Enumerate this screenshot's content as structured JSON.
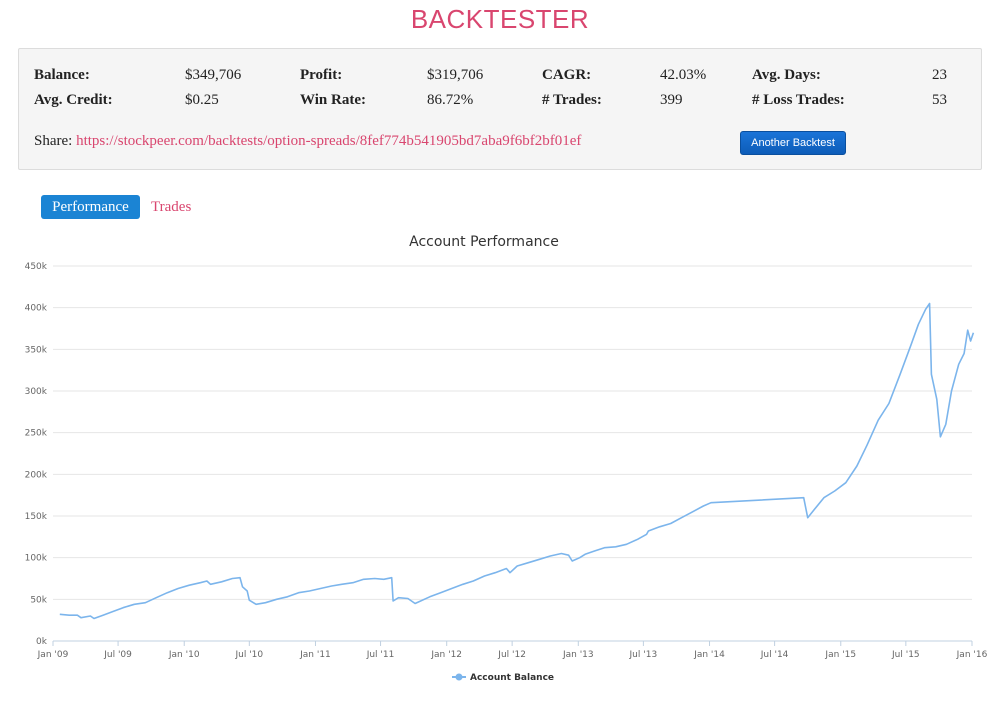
{
  "header": {
    "title": "BACKTESTER"
  },
  "stats": [
    {
      "id": "balance",
      "label": "Balance:",
      "value": "$349,706"
    },
    {
      "id": "profit",
      "label": "Profit:",
      "value": "$319,706"
    },
    {
      "id": "cagr",
      "label": "CAGR:",
      "value": "42.03%"
    },
    {
      "id": "avg-days",
      "label": "Avg. Days:",
      "value": "23"
    },
    {
      "id": "avg-credit",
      "label": "Avg. Credit:",
      "value": "$0.25"
    },
    {
      "id": "win-rate",
      "label": "Win Rate:",
      "value": "86.72%"
    },
    {
      "id": "trades",
      "label": "# Trades:",
      "value": "399"
    },
    {
      "id": "loss-trades",
      "label": "# Loss Trades:",
      "value": "53"
    }
  ],
  "share": {
    "label": "Share:",
    "url": "https://stockpeer.com/backtests/option-spreads/8fef774b541905bd7aba9f6bf2bf01ef"
  },
  "actions": {
    "another_backtest": "Another Backtest"
  },
  "tabs": [
    {
      "label": "Performance",
      "active": true
    },
    {
      "label": "Trades",
      "active": false
    }
  ],
  "colors": {
    "accent": "#d9466f",
    "series": "#7cb5ec",
    "button": "#1565c0",
    "tab_active": "#1b84d4"
  },
  "chart_data": {
    "type": "line",
    "title": "Account Performance",
    "xlabel": "",
    "ylabel": "",
    "x_ticks": [
      "Jan '09",
      "Jul '09",
      "Jan '10",
      "Jul '10",
      "Jan '11",
      "Jul '11",
      "Jan '12",
      "Jul '12",
      "Jan '13",
      "Jul '13",
      "Jan '14",
      "Jul '14",
      "Jan '15",
      "Jul '15",
      "Jan '16"
    ],
    "y_ticks": [
      "0k",
      "50k",
      "100k",
      "150k",
      "200k",
      "250k",
      "300k",
      "350k",
      "400k",
      "450k"
    ],
    "ylim": [
      0,
      450000
    ],
    "xlim": [
      "2009-01-01",
      "2016-01-01"
    ],
    "grid": true,
    "legend": "bottom-center",
    "series": [
      {
        "name": "Account Balance",
        "points": [
          [
            "2009-01-20",
            32000
          ],
          [
            "2009-02-15",
            31000
          ],
          [
            "2009-03-10",
            31000
          ],
          [
            "2009-03-20",
            28000
          ],
          [
            "2009-04-15",
            30000
          ],
          [
            "2009-04-25",
            27000
          ],
          [
            "2009-05-20",
            31000
          ],
          [
            "2009-06-15",
            35000
          ],
          [
            "2009-07-15",
            40000
          ],
          [
            "2009-08-15",
            44000
          ],
          [
            "2009-09-15",
            46000
          ],
          [
            "2009-10-15",
            52000
          ],
          [
            "2009-11-15",
            58000
          ],
          [
            "2009-12-15",
            63000
          ],
          [
            "2010-01-15",
            67000
          ],
          [
            "2010-02-15",
            70000
          ],
          [
            "2010-03-05",
            72000
          ],
          [
            "2010-03-15",
            68000
          ],
          [
            "2010-04-15",
            71000
          ],
          [
            "2010-05-15",
            75000
          ],
          [
            "2010-06-05",
            76000
          ],
          [
            "2010-06-12",
            65000
          ],
          [
            "2010-06-25",
            60000
          ],
          [
            "2010-07-01",
            49000
          ],
          [
            "2010-07-20",
            44000
          ],
          [
            "2010-08-15",
            46000
          ],
          [
            "2010-09-15",
            50000
          ],
          [
            "2010-10-15",
            53000
          ],
          [
            "2010-11-15",
            58000
          ],
          [
            "2010-12-15",
            60000
          ],
          [
            "2011-01-15",
            63000
          ],
          [
            "2011-02-15",
            66000
          ],
          [
            "2011-03-15",
            68000
          ],
          [
            "2011-04-15",
            70000
          ],
          [
            "2011-05-15",
            74000
          ],
          [
            "2011-06-15",
            75000
          ],
          [
            "2011-07-10",
            74000
          ],
          [
            "2011-08-01",
            76000
          ],
          [
            "2011-08-05",
            48000
          ],
          [
            "2011-08-20",
            52000
          ],
          [
            "2011-09-15",
            51000
          ],
          [
            "2011-10-05",
            45000
          ],
          [
            "2011-11-15",
            53000
          ],
          [
            "2011-12-15",
            58000
          ],
          [
            "2012-01-15",
            63000
          ],
          [
            "2012-02-15",
            68000
          ],
          [
            "2012-03-15",
            72000
          ],
          [
            "2012-04-15",
            78000
          ],
          [
            "2012-05-15",
            82000
          ],
          [
            "2012-06-15",
            87000
          ],
          [
            "2012-06-25",
            82000
          ],
          [
            "2012-07-15",
            90000
          ],
          [
            "2012-08-15",
            94000
          ],
          [
            "2012-09-15",
            98000
          ],
          [
            "2012-10-15",
            102000
          ],
          [
            "2012-11-15",
            105000
          ],
          [
            "2012-12-05",
            103000
          ],
          [
            "2012-12-15",
            96000
          ],
          [
            "2013-01-05",
            100000
          ],
          [
            "2013-01-20",
            104000
          ],
          [
            "2013-02-15",
            108000
          ],
          [
            "2013-03-15",
            112000
          ],
          [
            "2013-04-15",
            113000
          ],
          [
            "2013-05-15",
            116000
          ],
          [
            "2013-06-15",
            122000
          ],
          [
            "2013-07-10",
            128000
          ],
          [
            "2013-07-15",
            132000
          ],
          [
            "2013-08-15",
            137000
          ],
          [
            "2013-09-15",
            141000
          ],
          [
            "2013-10-15",
            148000
          ],
          [
            "2013-11-15",
            155000
          ],
          [
            "2013-12-15",
            162000
          ],
          [
            "2014-01-05",
            166000
          ],
          [
            "2014-09-20",
            172000
          ],
          [
            "2014-10-01",
            148000
          ],
          [
            "2014-10-20",
            158000
          ],
          [
            "2014-11-15",
            172000
          ],
          [
            "2014-12-15",
            180000
          ],
          [
            "2015-01-15",
            190000
          ],
          [
            "2015-02-15",
            210000
          ],
          [
            "2015-03-15",
            235000
          ],
          [
            "2015-04-15",
            265000
          ],
          [
            "2015-05-15",
            285000
          ],
          [
            "2015-06-15",
            320000
          ],
          [
            "2015-07-15",
            355000
          ],
          [
            "2015-08-05",
            380000
          ],
          [
            "2015-08-25",
            398000
          ],
          [
            "2015-09-05",
            405000
          ],
          [
            "2015-09-10",
            320000
          ],
          [
            "2015-09-25",
            290000
          ],
          [
            "2015-10-05",
            245000
          ],
          [
            "2015-10-20",
            260000
          ],
          [
            "2015-11-05",
            300000
          ],
          [
            "2015-11-25",
            332000
          ],
          [
            "2015-12-10",
            345000
          ],
          [
            "2015-12-20",
            373000
          ],
          [
            "2015-12-28",
            360000
          ],
          [
            "2016-01-05",
            370000
          ]
        ]
      }
    ]
  }
}
